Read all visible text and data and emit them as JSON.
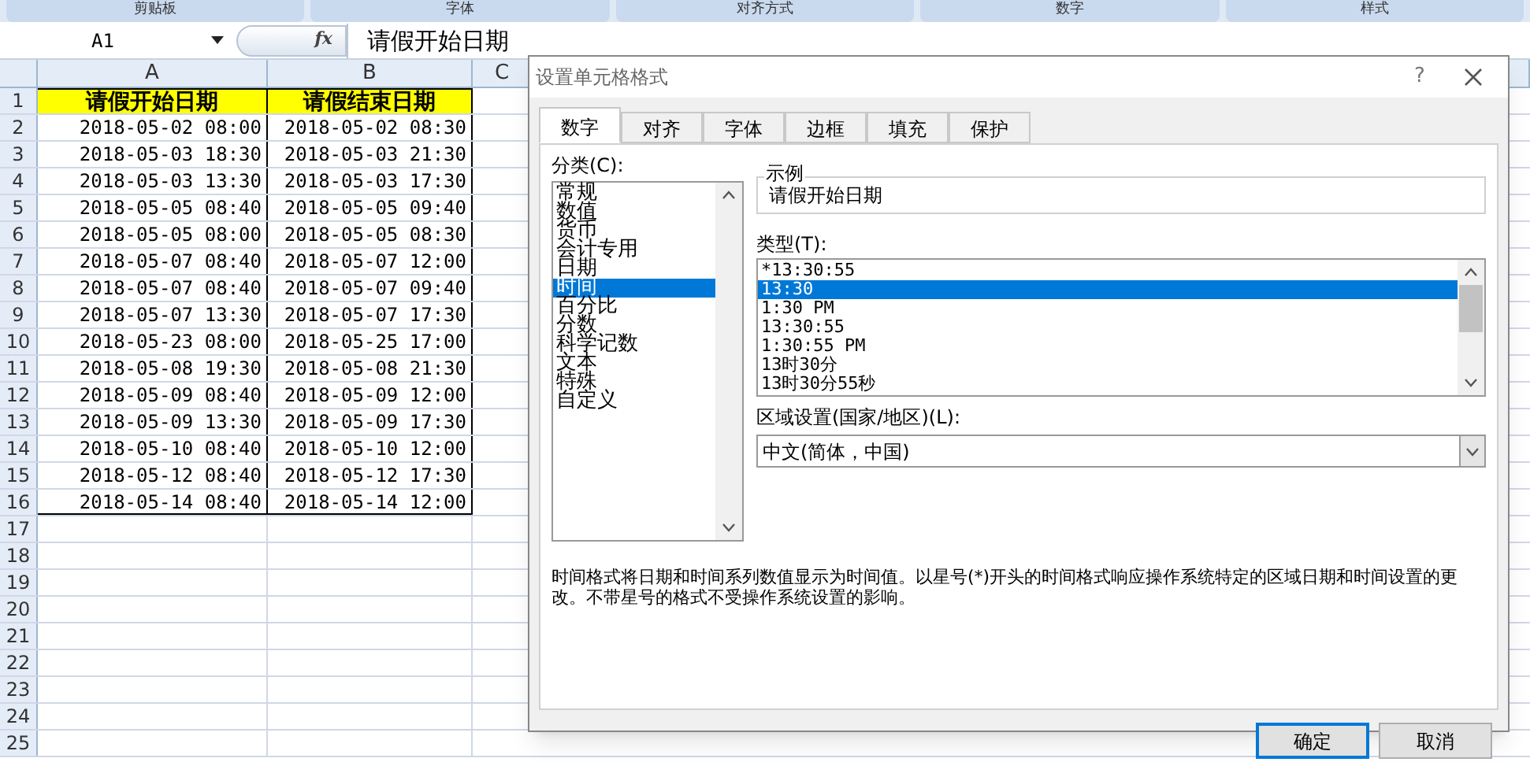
{
  "ribbon_groups": [
    "剪贴板",
    "字体",
    "对齐方式",
    "数字",
    "样式"
  ],
  "formula_bar": {
    "name_box": "A1",
    "fx": "fx",
    "value": "请假开始日期"
  },
  "sheet": {
    "columns": [
      "A",
      "B",
      "C"
    ],
    "header": [
      "请假开始日期",
      "请假结束日期"
    ],
    "rows": [
      [
        "2018-05-02 08:00",
        "2018-05-02 08:30"
      ],
      [
        "2018-05-03 18:30",
        "2018-05-03 21:30"
      ],
      [
        "2018-05-03 13:30",
        "2018-05-03 17:30"
      ],
      [
        "2018-05-05 08:40",
        "2018-05-05 09:40"
      ],
      [
        "2018-05-05 08:00",
        "2018-05-05 08:30"
      ],
      [
        "2018-05-07 08:40",
        "2018-05-07 12:00"
      ],
      [
        "2018-05-07 08:40",
        "2018-05-07 09:40"
      ],
      [
        "2018-05-07 13:30",
        "2018-05-07 17:30"
      ],
      [
        "2018-05-23 08:00",
        "2018-05-25 17:00"
      ],
      [
        "2018-05-08 19:30",
        "2018-05-08 21:30"
      ],
      [
        "2018-05-09 08:40",
        "2018-05-09 12:00"
      ],
      [
        "2018-05-09 13:30",
        "2018-05-09 17:30"
      ],
      [
        "2018-05-10 08:40",
        "2018-05-10 12:00"
      ],
      [
        "2018-05-12 08:40",
        "2018-05-12 17:30"
      ],
      [
        "2018-05-14 08:40",
        "2018-05-14 12:00"
      ]
    ],
    "row_numbers": [
      "1",
      "2",
      "3",
      "4",
      "5",
      "6",
      "7",
      "8",
      "9",
      "10",
      "11",
      "12",
      "13",
      "14",
      "15",
      "16",
      "17",
      "18",
      "19",
      "20",
      "21",
      "22",
      "23",
      "24",
      "25"
    ]
  },
  "dialog": {
    "title": "设置单元格格式",
    "help": "?",
    "tabs": [
      {
        "label": "数字",
        "selected": true
      },
      {
        "label": "对齐",
        "selected": false
      },
      {
        "label": "字体",
        "selected": false
      },
      {
        "label": "边框",
        "selected": false
      },
      {
        "label": "填充",
        "selected": false
      },
      {
        "label": "保护",
        "selected": false
      }
    ],
    "category_label": "分类(C):",
    "categories": [
      {
        "label": "常规",
        "selected": false
      },
      {
        "label": "数值",
        "selected": false
      },
      {
        "label": "货币",
        "selected": false
      },
      {
        "label": "会计专用",
        "selected": false
      },
      {
        "label": "日期",
        "selected": false
      },
      {
        "label": "时间",
        "selected": true
      },
      {
        "label": "百分比",
        "selected": false
      },
      {
        "label": "分数",
        "selected": false
      },
      {
        "label": "科学记数",
        "selected": false
      },
      {
        "label": "文本",
        "selected": false
      },
      {
        "label": "特殊",
        "selected": false
      },
      {
        "label": "自定义",
        "selected": false
      }
    ],
    "sample_label": "示例",
    "sample_value": "请假开始日期",
    "type_label": "类型(T):",
    "types": [
      {
        "label": "*13:30:55",
        "selected": false
      },
      {
        "label": "13:30",
        "selected": true
      },
      {
        "label": "1:30 PM",
        "selected": false
      },
      {
        "label": "13:30:55",
        "selected": false
      },
      {
        "label": "1:30:55 PM",
        "selected": false
      },
      {
        "label": "13时30分",
        "selected": false
      },
      {
        "label": "13时30分55秒",
        "selected": false
      }
    ],
    "locale_label": "区域设置(国家/地区)(L):",
    "locale_value": "中文(简体，中国)",
    "description": "时间格式将日期和时间系列数值显示为时间值。以星号(*)开头的时间格式响应操作系统特定的区域日期和时间设置的更改。不带星号的格式不受操作系统设置的影响。",
    "buttons": [
      "确定",
      "取消"
    ]
  }
}
